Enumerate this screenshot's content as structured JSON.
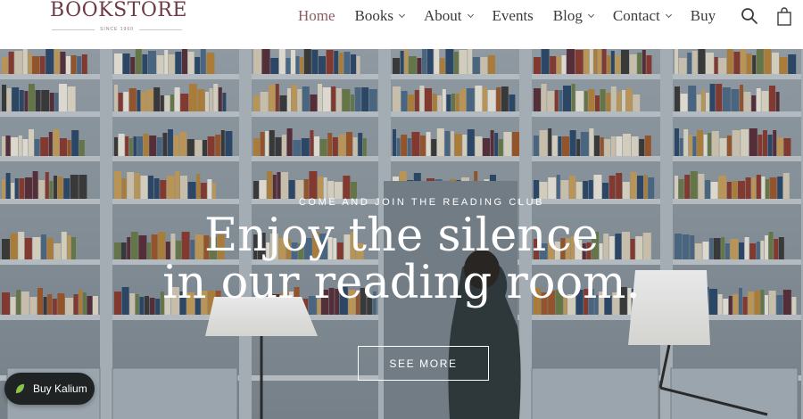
{
  "header": {
    "logo": "BOOKSTORE",
    "logo_tagline": "SINCE 1960",
    "nav": [
      {
        "label": "Home"
      },
      {
        "label": "Books"
      },
      {
        "label": "About"
      },
      {
        "label": "Events"
      },
      {
        "label": "Blog"
      },
      {
        "label": "Contact"
      },
      {
        "label": "Buy"
      }
    ],
    "icons": [
      "search-icon",
      "shopping-bag-icon"
    ]
  },
  "hero": {
    "kicker": "COME AND JOIN THE READING CLUB",
    "headline_line1": "Enjoy the silence",
    "headline_line2": "in our reading room.",
    "cta": "SEE MORE"
  },
  "floating": {
    "buy_label": "Buy Kalium"
  },
  "colors": {
    "brand": "#6e3a45",
    "nav_active": "#8d5a64",
    "nav_text": "#3b3b3b",
    "hero_text": "#ffffff",
    "pill_bg": "#1f2324",
    "leaf": "#8bc34a"
  }
}
